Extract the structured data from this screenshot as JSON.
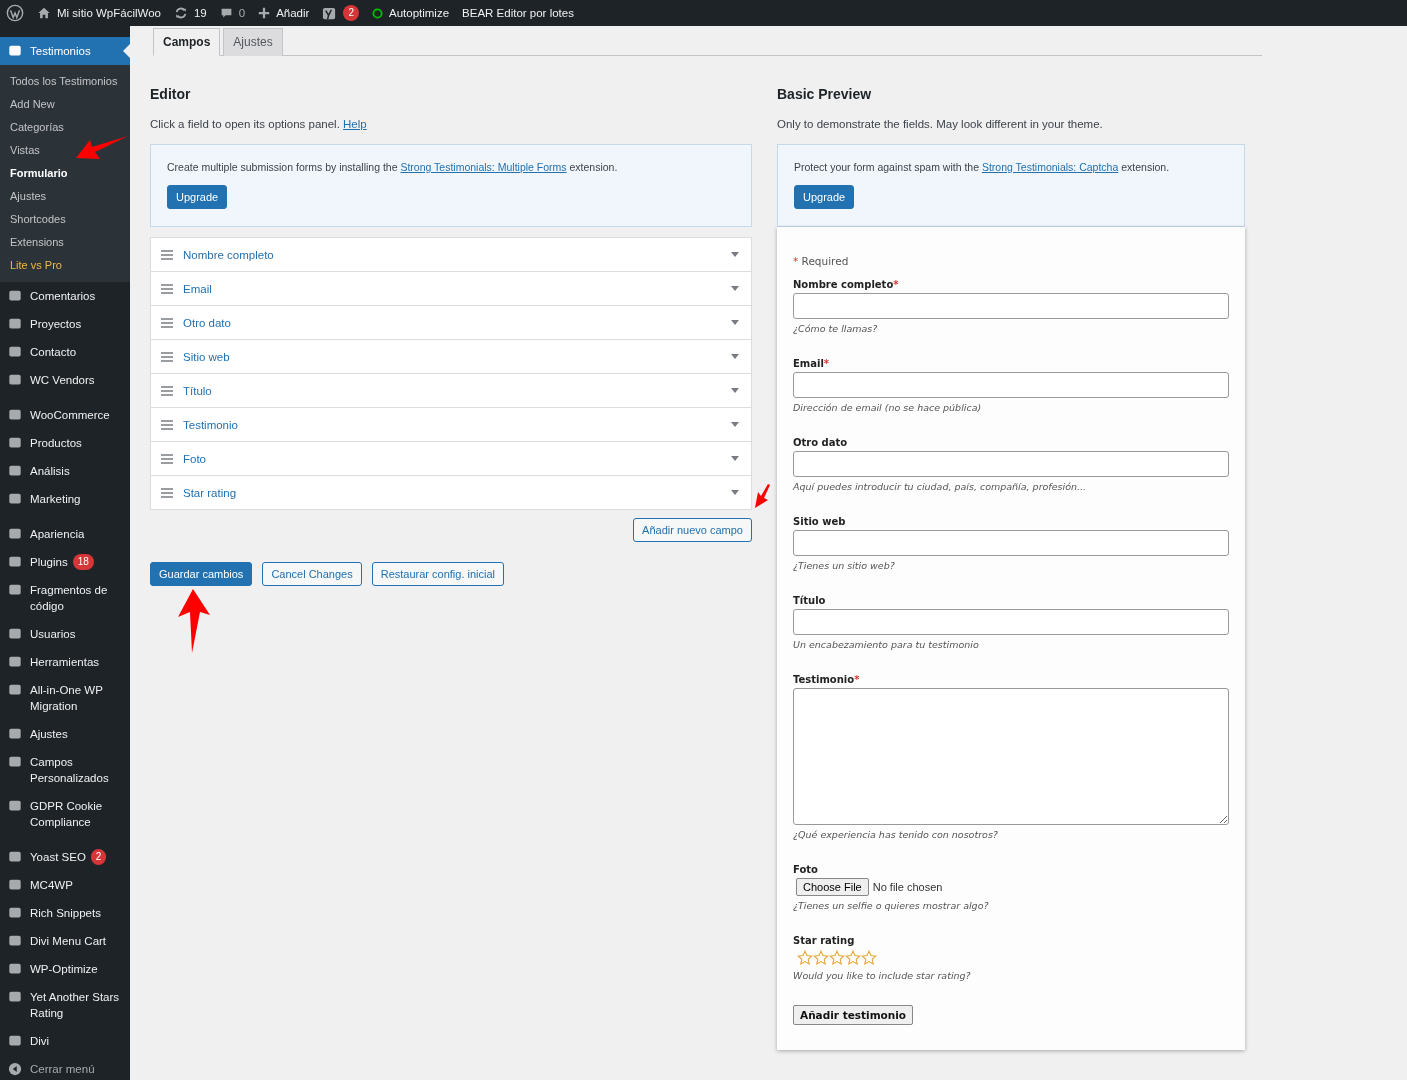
{
  "admin_bar": {
    "site": "Mi sitio WpFácilWoo",
    "updates": "19",
    "comments": "0",
    "add": "Añadir",
    "yoast_badge": "2",
    "autoptimize": "Autoptimize",
    "bear": "BEAR Editor por lotes"
  },
  "sidebar": {
    "items": [
      {
        "kind": "item",
        "label": "Testimonios",
        "selected": true,
        "children": [
          {
            "label": "Todos los Testimonios",
            "selected": false,
            "kind": "link"
          },
          {
            "label": "Add New",
            "selected": false,
            "kind": "link"
          },
          {
            "label": "Categorías",
            "selected": false,
            "kind": "link"
          },
          {
            "label": "Vistas",
            "selected": false,
            "kind": "link"
          },
          {
            "label": "Formulario",
            "selected": true,
            "kind": "link"
          },
          {
            "label": "Ajustes",
            "selected": false,
            "kind": "link"
          },
          {
            "label": "Shortcodes",
            "selected": false,
            "kind": "link"
          },
          {
            "label": "Extensions",
            "selected": false,
            "kind": "link"
          },
          {
            "label": "Lite vs Pro",
            "selected": false,
            "kind": "promo"
          }
        ]
      },
      {
        "kind": "item",
        "label": "Comentarios",
        "selected": false
      },
      {
        "kind": "item",
        "label": "Proyectos",
        "selected": false
      },
      {
        "kind": "item",
        "label": "Contacto",
        "selected": false
      },
      {
        "kind": "item",
        "label": "WC Vendors",
        "selected": false
      },
      {
        "kind": "separator"
      },
      {
        "kind": "item",
        "label": "WooCommerce",
        "selected": false
      },
      {
        "kind": "item",
        "label": "Productos",
        "selected": false
      },
      {
        "kind": "item",
        "label": "Análisis",
        "selected": false
      },
      {
        "kind": "item",
        "label": "Marketing",
        "selected": false
      },
      {
        "kind": "separator"
      },
      {
        "kind": "item",
        "label": "Apariencia",
        "selected": false
      },
      {
        "kind": "item",
        "label": "Plugins",
        "selected": false,
        "badge": "18"
      },
      {
        "kind": "item",
        "label": "Fragmentos de código",
        "selected": false
      },
      {
        "kind": "item",
        "label": "Usuarios",
        "selected": false
      },
      {
        "kind": "item",
        "label": "Herramientas",
        "selected": false
      },
      {
        "kind": "item",
        "label": "All-in-One WP Migration",
        "selected": false
      },
      {
        "kind": "item",
        "label": "Ajustes",
        "selected": false
      },
      {
        "kind": "item",
        "label": "Campos Personalizados",
        "selected": false
      },
      {
        "kind": "item",
        "label": "GDPR Cookie Compliance",
        "selected": false
      },
      {
        "kind": "separator"
      },
      {
        "kind": "item",
        "label": "Yoast SEO",
        "selected": false,
        "badge": "2"
      },
      {
        "kind": "item",
        "label": "MC4WP",
        "selected": false
      },
      {
        "kind": "item",
        "label": "Rich Snippets",
        "selected": false
      },
      {
        "kind": "item",
        "label": "Divi Menu Cart",
        "selected": false
      },
      {
        "kind": "item",
        "label": "WP-Optimize",
        "selected": false
      },
      {
        "kind": "item",
        "label": "Yet Another Stars Rating",
        "selected": false
      },
      {
        "kind": "item",
        "label": "Divi",
        "selected": false
      },
      {
        "kind": "collapse",
        "label": "Cerrar menú",
        "selected": false
      }
    ]
  },
  "tabs": [
    {
      "label": "Campos",
      "selected": true
    },
    {
      "label": "Ajustes",
      "selected": false
    }
  ],
  "editor": {
    "title": "Editor",
    "description": {
      "before": "Click a field to open its options panel. ",
      "link": "Help"
    },
    "notice": {
      "before": "Create multiple submission forms by installing the ",
      "link": "Strong Testimonials: Multiple Forms",
      "after": " extension.",
      "button": "Upgrade"
    },
    "fields": [
      "Nombre completo",
      "Email",
      "Otro dato",
      "Sitio web",
      "Título",
      "Testimonio",
      "Foto",
      "Star rating"
    ],
    "add_field": "Añadir nuevo campo",
    "buttons": [
      {
        "label": "Guardar cambios",
        "kind": "primary"
      },
      {
        "label": "Cancel Changes",
        "kind": "secondary"
      },
      {
        "label": "Restaurar config. inicial",
        "kind": "secondary"
      }
    ]
  },
  "preview": {
    "title": "Basic Preview",
    "description": "Only to demonstrate the fields. May look different in your theme.",
    "notice": {
      "before": "Protect your form against spam with the ",
      "link": "Strong Testimonials: Captcha",
      "after": " extension.",
      "button": "Upgrade"
    },
    "required_mark": "*",
    "required_note": "Required",
    "fields": [
      {
        "kind": "text",
        "label": "Nombre completo",
        "required": true,
        "hint": "¿Cómo te llamas?"
      },
      {
        "kind": "text",
        "label": "Email",
        "required": true,
        "hint": "Dirección de email (no se hace pública)"
      },
      {
        "kind": "text",
        "label": "Otro dato",
        "required": false,
        "hint": "Aquí puedes introducir tu ciudad, país, compañía, profesión..."
      },
      {
        "kind": "text",
        "label": "Sitio web",
        "required": false,
        "hint": "¿Tienes un sitio web?"
      },
      {
        "kind": "text",
        "label": "Título",
        "required": false,
        "hint": "Un encabezamiento para tu testimonio"
      },
      {
        "kind": "textarea",
        "label": "Testimonio",
        "required": true,
        "hint": "¿Qué experiencia has tenido con nosotros?"
      },
      {
        "kind": "file",
        "label": "Foto",
        "required": false,
        "button": "Choose File",
        "status": "No file chosen",
        "hint": "¿Tienes un selfie o quieres mostrar algo?"
      },
      {
        "kind": "stars",
        "label": "Star rating",
        "required": false,
        "stars": 0,
        "hint": "Would you like to include star rating?"
      }
    ],
    "submit": "Añadir testimonio"
  }
}
